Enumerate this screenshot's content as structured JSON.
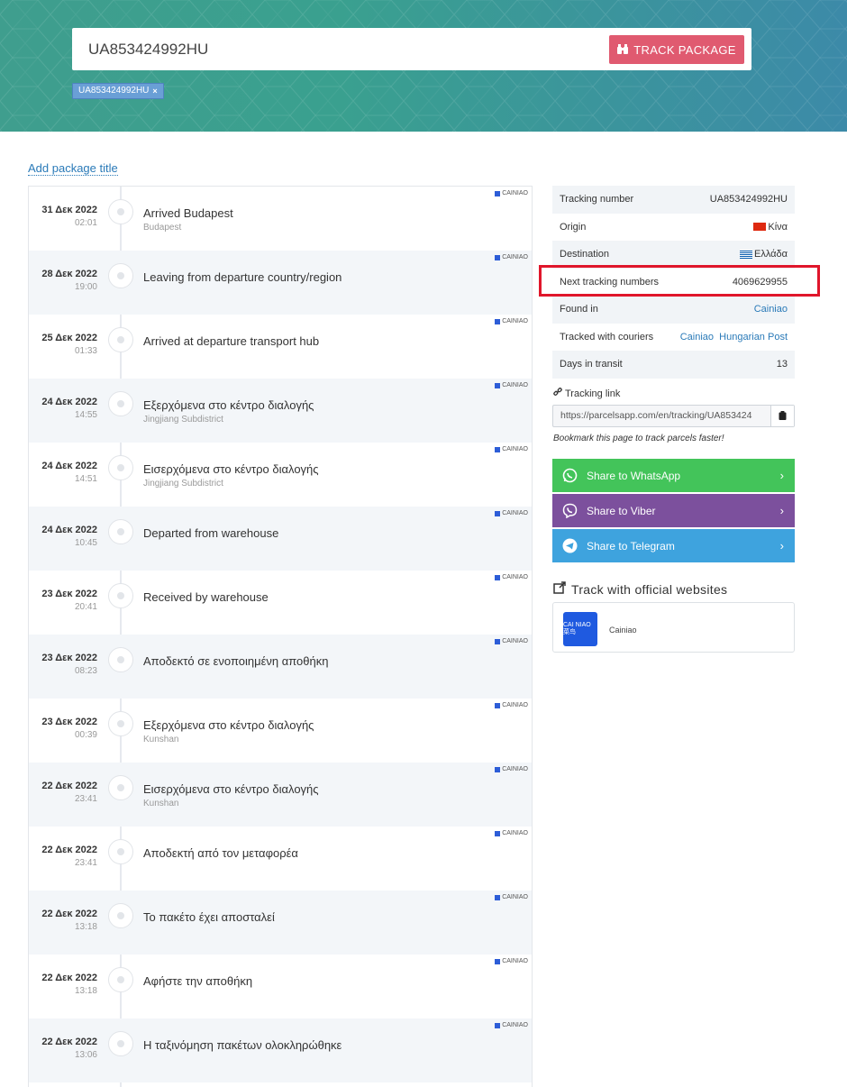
{
  "search": {
    "value": "UA853424992HU",
    "button_label": "TRACK PACKAGE",
    "chip": "UA853424992HU"
  },
  "add_title": "Add package title",
  "events": [
    {
      "date": "31 Δεκ 2022",
      "time": "02:01",
      "title": "Arrived Budapest",
      "sub": "Budapest",
      "courier": "CAINIAO"
    },
    {
      "date": "28 Δεκ 2022",
      "time": "19:00",
      "title": "Leaving from departure country/region",
      "sub": "",
      "courier": "CAINIAO"
    },
    {
      "date": "25 Δεκ 2022",
      "time": "01:33",
      "title": "Arrived at departure transport hub",
      "sub": "",
      "courier": "CAINIAO"
    },
    {
      "date": "24 Δεκ 2022",
      "time": "14:55",
      "title": "Εξερχόμενα στο κέντρο διαλογής",
      "sub": "Jingjiang Subdistrict",
      "courier": "CAINIAO"
    },
    {
      "date": "24 Δεκ 2022",
      "time": "14:51",
      "title": "Εισερχόμενα στο κέντρο διαλογής",
      "sub": "Jingjiang Subdistrict",
      "courier": "CAINIAO"
    },
    {
      "date": "24 Δεκ 2022",
      "time": "10:45",
      "title": "Departed from warehouse",
      "sub": "",
      "courier": "CAINIAO"
    },
    {
      "date": "23 Δεκ 2022",
      "time": "20:41",
      "title": "Received by warehouse",
      "sub": "",
      "courier": "CAINIAO"
    },
    {
      "date": "23 Δεκ 2022",
      "time": "08:23",
      "title": "Αποδεκτό σε ενοποιημένη αποθήκη",
      "sub": "",
      "courier": "CAINIAO"
    },
    {
      "date": "23 Δεκ 2022",
      "time": "00:39",
      "title": "Εξερχόμενα στο κέντρο διαλογής",
      "sub": "Kunshan",
      "courier": "CAINIAO"
    },
    {
      "date": "22 Δεκ 2022",
      "time": "23:41",
      "title": "Εισερχόμενα στο κέντρο διαλογής",
      "sub": "Kunshan",
      "courier": "CAINIAO"
    },
    {
      "date": "22 Δεκ 2022",
      "time": "23:41",
      "title": "Αποδεκτή από τον μεταφορέα",
      "sub": "",
      "courier": "CAINIAO"
    },
    {
      "date": "22 Δεκ 2022",
      "time": "13:18",
      "title": "Το πακέτο έχει αποσταλεί",
      "sub": "",
      "courier": "CAINIAO"
    },
    {
      "date": "22 Δεκ 2022",
      "time": "13:18",
      "title": "Αφήστε την αποθήκη",
      "sub": "",
      "courier": "CAINIAO"
    },
    {
      "date": "22 Δεκ 2022",
      "time": "13:06",
      "title": "Η ταξινόμηση πακέτων ολοκληρώθηκε",
      "sub": "",
      "courier": "CAINIAO"
    }
  ],
  "info": {
    "tracking_number_label": "Tracking number",
    "tracking_number": "UA853424992HU",
    "origin_label": "Origin",
    "origin": "Κίνα",
    "destination_label": "Destination",
    "destination": "Ελλάδα",
    "next_label": "Next tracking numbers",
    "next": "4069629955",
    "found_label": "Found in",
    "found": "Cainiao",
    "couriers_label": "Tracked with couriers",
    "courier_1": "Cainiao",
    "courier_2": "Hungarian Post",
    "days_label": "Days in transit",
    "days": "13"
  },
  "tracking_link": {
    "label": "Tracking link",
    "url": "https://parcelsapp.com/en/tracking/UA853424",
    "bookmark": "Bookmark this page to track parcels faster!"
  },
  "share": {
    "whatsapp": "Share to WhatsApp",
    "viber": "Share to Viber",
    "telegram": "Share to Telegram"
  },
  "official": {
    "title": "Track with official websites",
    "name": "Cainiao",
    "logo_text": "CAI NIAO 菜鸟"
  },
  "colors": {
    "accent_red": "#e05a70",
    "link": "#2a7ab8",
    "whatsapp": "#43c45a",
    "viber": "#7c509d",
    "telegram": "#3ea3de",
    "highlight": "#e0162b"
  }
}
